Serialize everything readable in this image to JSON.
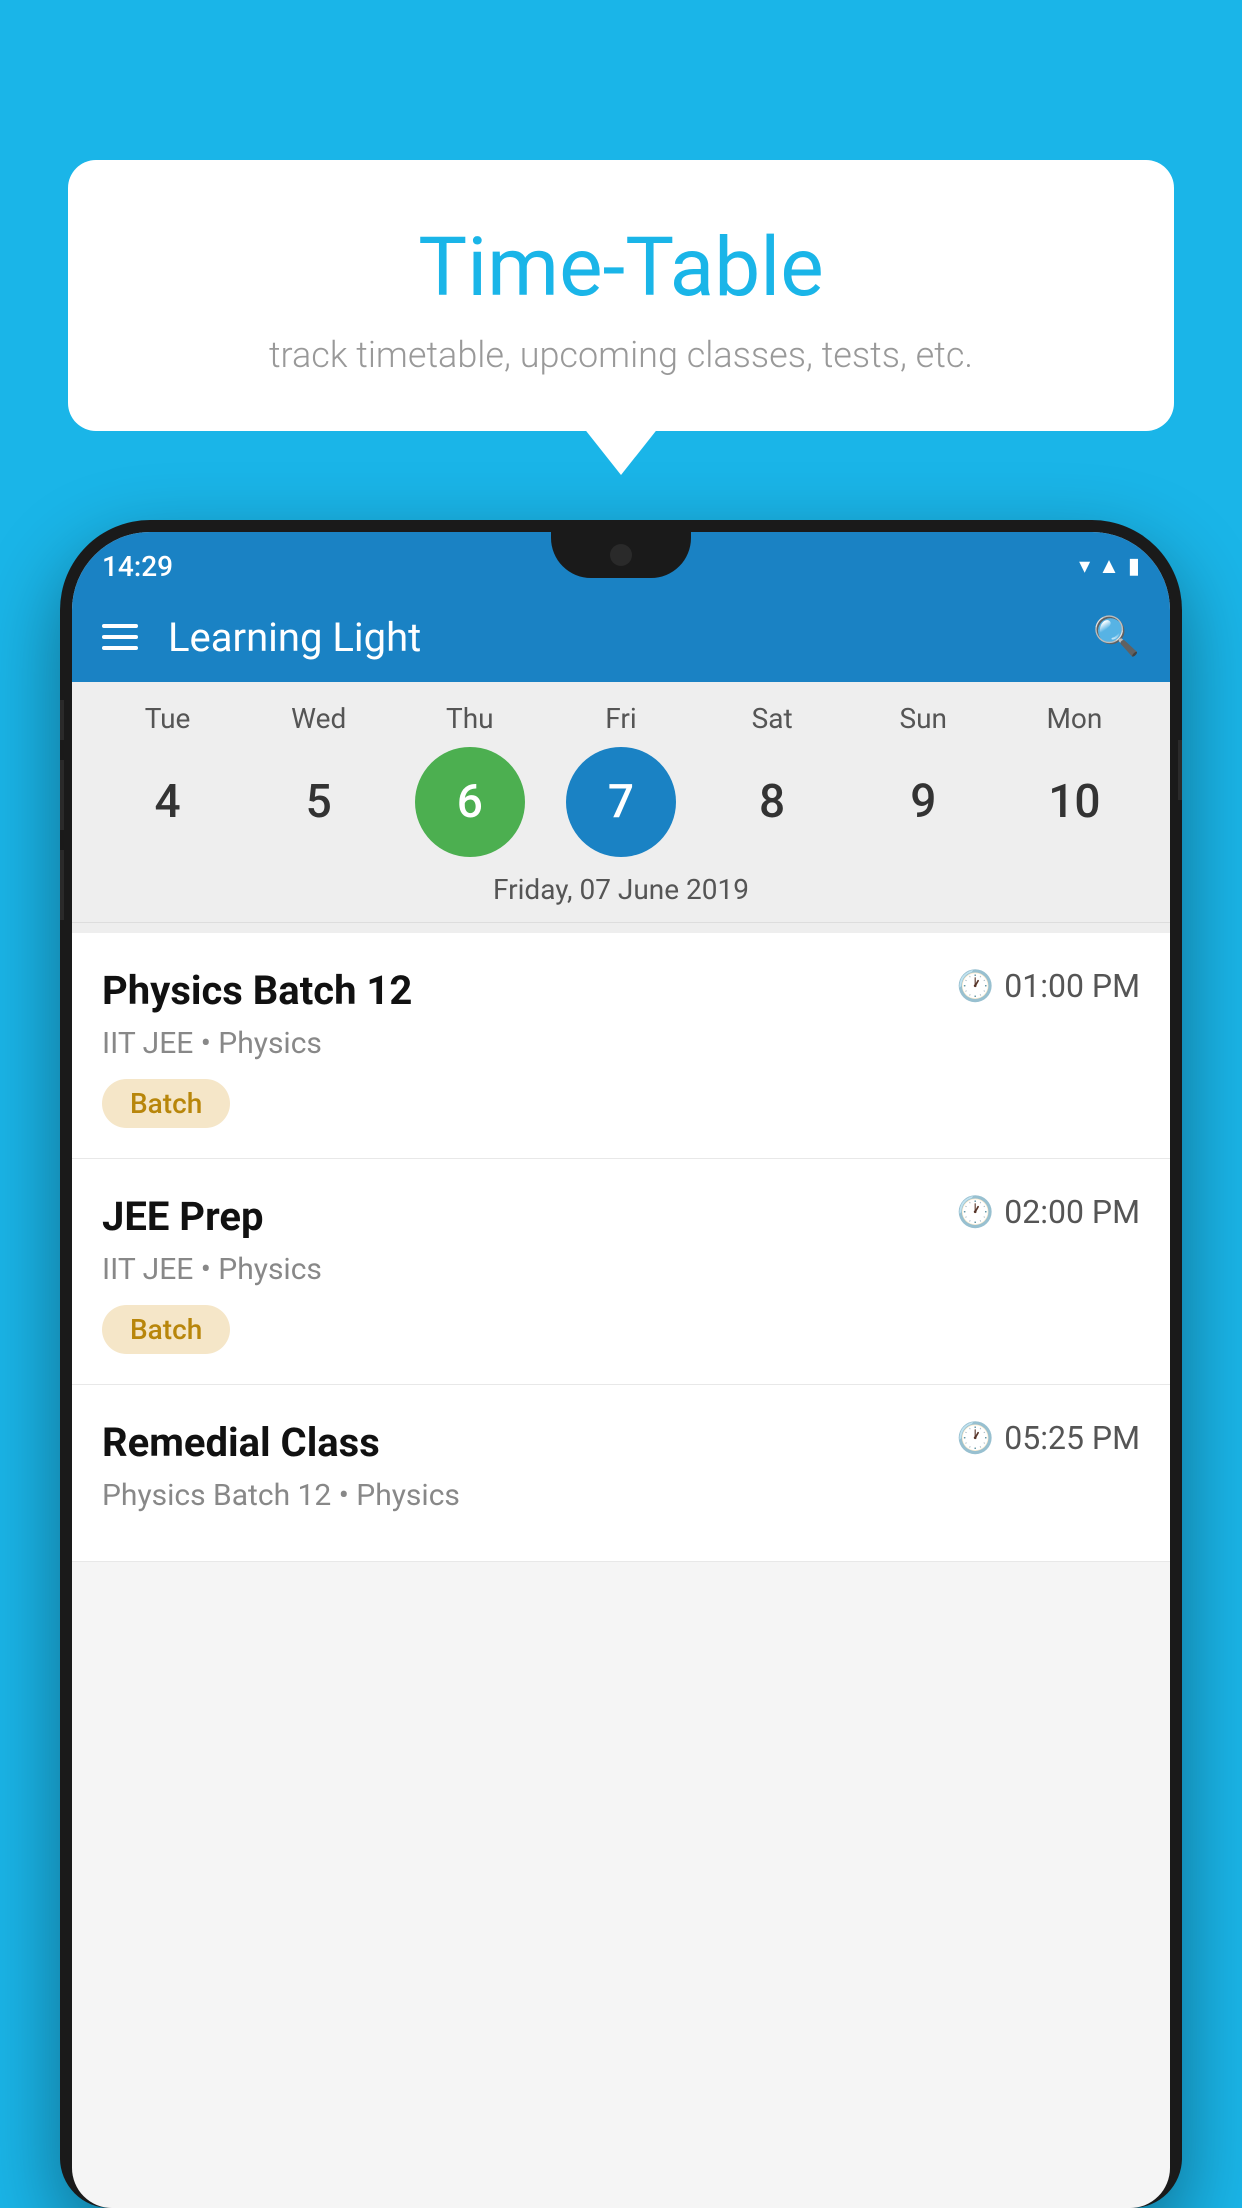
{
  "background_color": "#1ab5e8",
  "tooltip": {
    "title": "Time-Table",
    "subtitle": "track timetable, upcoming classes, tests, etc."
  },
  "status_bar": {
    "time": "14:29"
  },
  "app_bar": {
    "title": "Learning Light"
  },
  "calendar": {
    "days": [
      {
        "label": "Tue",
        "num": "4"
      },
      {
        "label": "Wed",
        "num": "5"
      },
      {
        "label": "Thu",
        "num": "6",
        "state": "today"
      },
      {
        "label": "Fri",
        "num": "7",
        "state": "selected"
      },
      {
        "label": "Sat",
        "num": "8"
      },
      {
        "label": "Sun",
        "num": "9"
      },
      {
        "label": "Mon",
        "num": "10"
      }
    ],
    "selected_date": "Friday, 07 June 2019"
  },
  "schedule": [
    {
      "title": "Physics Batch 12",
      "time": "01:00 PM",
      "sub": "IIT JEE • Physics",
      "tag": "Batch"
    },
    {
      "title": "JEE Prep",
      "time": "02:00 PM",
      "sub": "IIT JEE • Physics",
      "tag": "Batch"
    },
    {
      "title": "Remedial Class",
      "time": "05:25 PM",
      "sub": "Physics Batch 12 • Physics",
      "tag": ""
    }
  ]
}
